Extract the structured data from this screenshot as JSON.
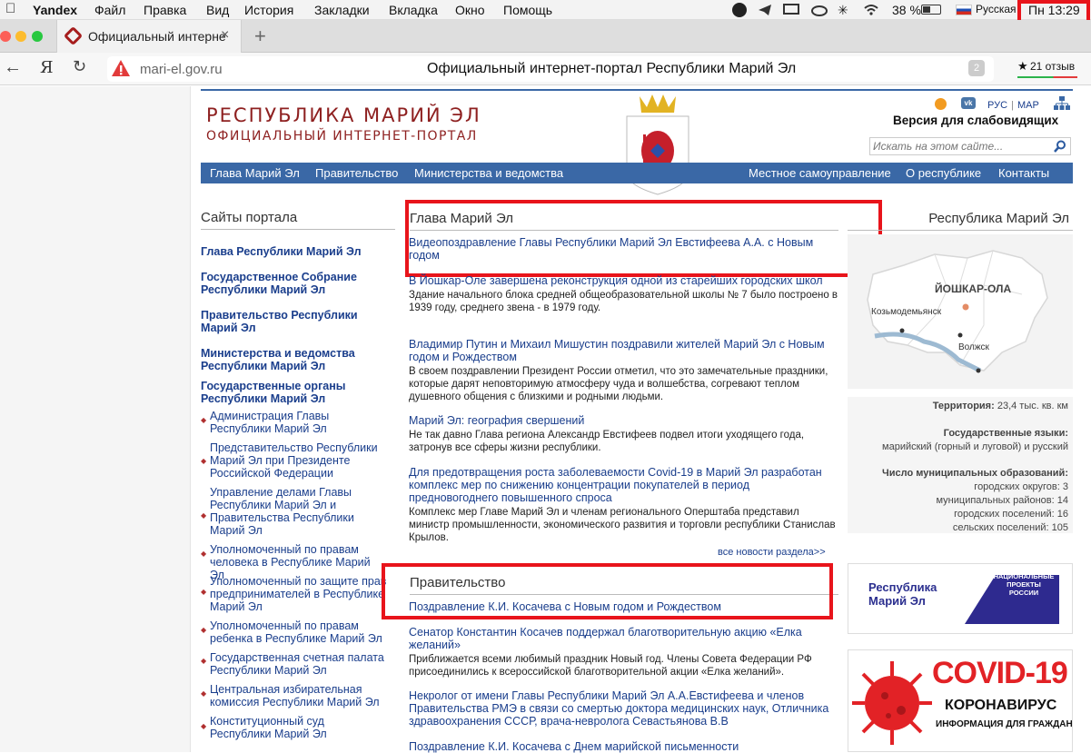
{
  "menubar": {
    "app": "Yandex",
    "items": [
      "Файл",
      "Правка",
      "Вид",
      "История",
      "Закладки",
      "Вкладка",
      "Окно",
      "Помощь"
    ],
    "battery": "38 %",
    "lang": "Русская",
    "clock": "Пн 13:29"
  },
  "tab": {
    "title": "Официальный интерне"
  },
  "address": {
    "url": "mari-el.gov.ru",
    "page_title": "Официальный интернет-портал Республики Марий Эл",
    "reviews": "21 отзыв",
    "star": "★",
    "tabs_count": "2"
  },
  "site": {
    "name": "РЕСПУБЛИКА МАРИЙ ЭЛ",
    "subtitle": "ОФИЦИАЛЬНЫЙ ИНТЕРНЕТ-ПОРТАЛ",
    "lang_rus": "РУС",
    "lang_mar": "МАР",
    "sep": "|",
    "low_vision": "Версия для слабовидящих",
    "search_placeholder": "Искать на этом сайте..."
  },
  "nav": {
    "left": [
      "Глава Марий Эл",
      "Правительство",
      "Министерства и ведомства"
    ],
    "right": [
      "Местное самоуправление",
      "О республике",
      "Контакты"
    ]
  },
  "sidebar": {
    "title": "Сайты портала",
    "bold": [
      "Глава Республики Марий Эл",
      "Государственное Собрание Республики Марий Эл",
      "Правительство Республики Марий Эл",
      "Министерства и ведомства Республики Марий Эл",
      "Государственные органы Республики Марий Эл"
    ],
    "items": [
      "Администрация Главы Республики Марий Эл",
      "Представительство Республики Марий Эл при Президенте Российской Федерации",
      "Управление делами Главы Республики Марий Эл и Правительства Республики Марий Эл",
      "Уполномоченный по правам человека в Республике Марий Эл",
      "Уполномоченный по защите прав предпринимателей в Республике Марий Эл",
      "Уполномоченный по правам ребенка в Республике Марий Эл",
      "Государственная счетная палата Республики Марий Эл",
      "Центральная избирательная комиссия Республики Марий Эл",
      "Конституционный суд Республики Марий Эл"
    ]
  },
  "glava": {
    "title": "Глава Марий Эл",
    "news": [
      {
        "h": "Видеопоздравление Главы Республики Марий Эл Евстифеева А.А. с Новым годом",
        "t": ""
      },
      {
        "h": "В Йошкар-Оле завершена реконструкция одной из старейших городских школ",
        "t": "Здание начального блока средней общеобразовательной школы № 7 было построено в 1939 году, среднего звена - в 1979 году."
      },
      {
        "h": "Владимир Путин и Михаил Мишустин поздравили жителей Марий Эл с Новым годом и Рождеством",
        "t": "В своем поздравлении Президент России отметил, что это замечательные праздники, которые дарят неповторимую атмосферу чуда и волшебства, согревают теплом душевного общения с близкими и родными людьми."
      },
      {
        "h": "Марий Эл: география свершений",
        "t": "Не так давно Глава региона Александр Евстифеев подвел итоги уходящего года, затронув все сферы жизни республики."
      },
      {
        "h": "Для предотвращения роста заболеваемости Covid-19 в Марий Эл разработан комплекс мер по снижению концентрации покупателей в период предновогоднего повышенного спроса",
        "t": "Комплекс мер Главе Марий Эл и членам регионального Оперштаба представил министр промышленности, экономического развития и торговли республики Станислав Крылов."
      }
    ],
    "all_news": "все новости раздела>>"
  },
  "gov": {
    "title": "Правительство",
    "news": [
      {
        "h": "Поздравление К.И. Косачева с Новым годом и Рождеством",
        "t": ""
      },
      {
        "h": "Сенатор Константин Косачев поддержал благотворительную акцию «Елка желаний»",
        "t": "Приближается всеми любимый праздник Новый год. Члены Совета Федерации РФ присоединились к всероссийской благотворительной акции «Елка желаний»."
      },
      {
        "h": "Некролог от имени Главы Республики Марий Эл А.А.Евстифеева и членов Правительства РМЭ в связи со смертью доктора медицинских наук, Отличника здравоохранения СССР, врача-невролога Севастьянова В.В",
        "t": ""
      },
      {
        "h": "Поздравление К.И. Косачева с Днем марийской письменности",
        "t": ""
      }
    ]
  },
  "right": {
    "title": "Республика Марий Эл",
    "map_capital": "ЙОШКАР-ОЛА",
    "map_city1": "Козьмодемьянск",
    "map_city2": "Волжск",
    "territory_label": "Территория:",
    "territory_value": "23,4 тыс. кв. км",
    "languages_label": "Государственные языки:",
    "languages_value": "марийский (горный и луговой) и русский",
    "muni_label": "Число муниципальных образований:",
    "muni": [
      "городских округов: 3",
      "муниципальных районов: 14",
      "городских поселений: 16",
      "сельских поселений: 105"
    ],
    "banner1_left": "Республика Марий Эл",
    "banner1_right": "НАЦИОНАЛЬНЫЕ ПРОЕКТЫ РОССИИ",
    "covid_title": "COVID-19",
    "covid_sub": "КОРОНАВИРУС",
    "covid_info": "ИНФОРМАЦИЯ ДЛЯ ГРАЖДАН"
  },
  "colors": {
    "nav": "#3a68a6",
    "link": "#1a3e8c",
    "highlight": "#e8141b"
  }
}
